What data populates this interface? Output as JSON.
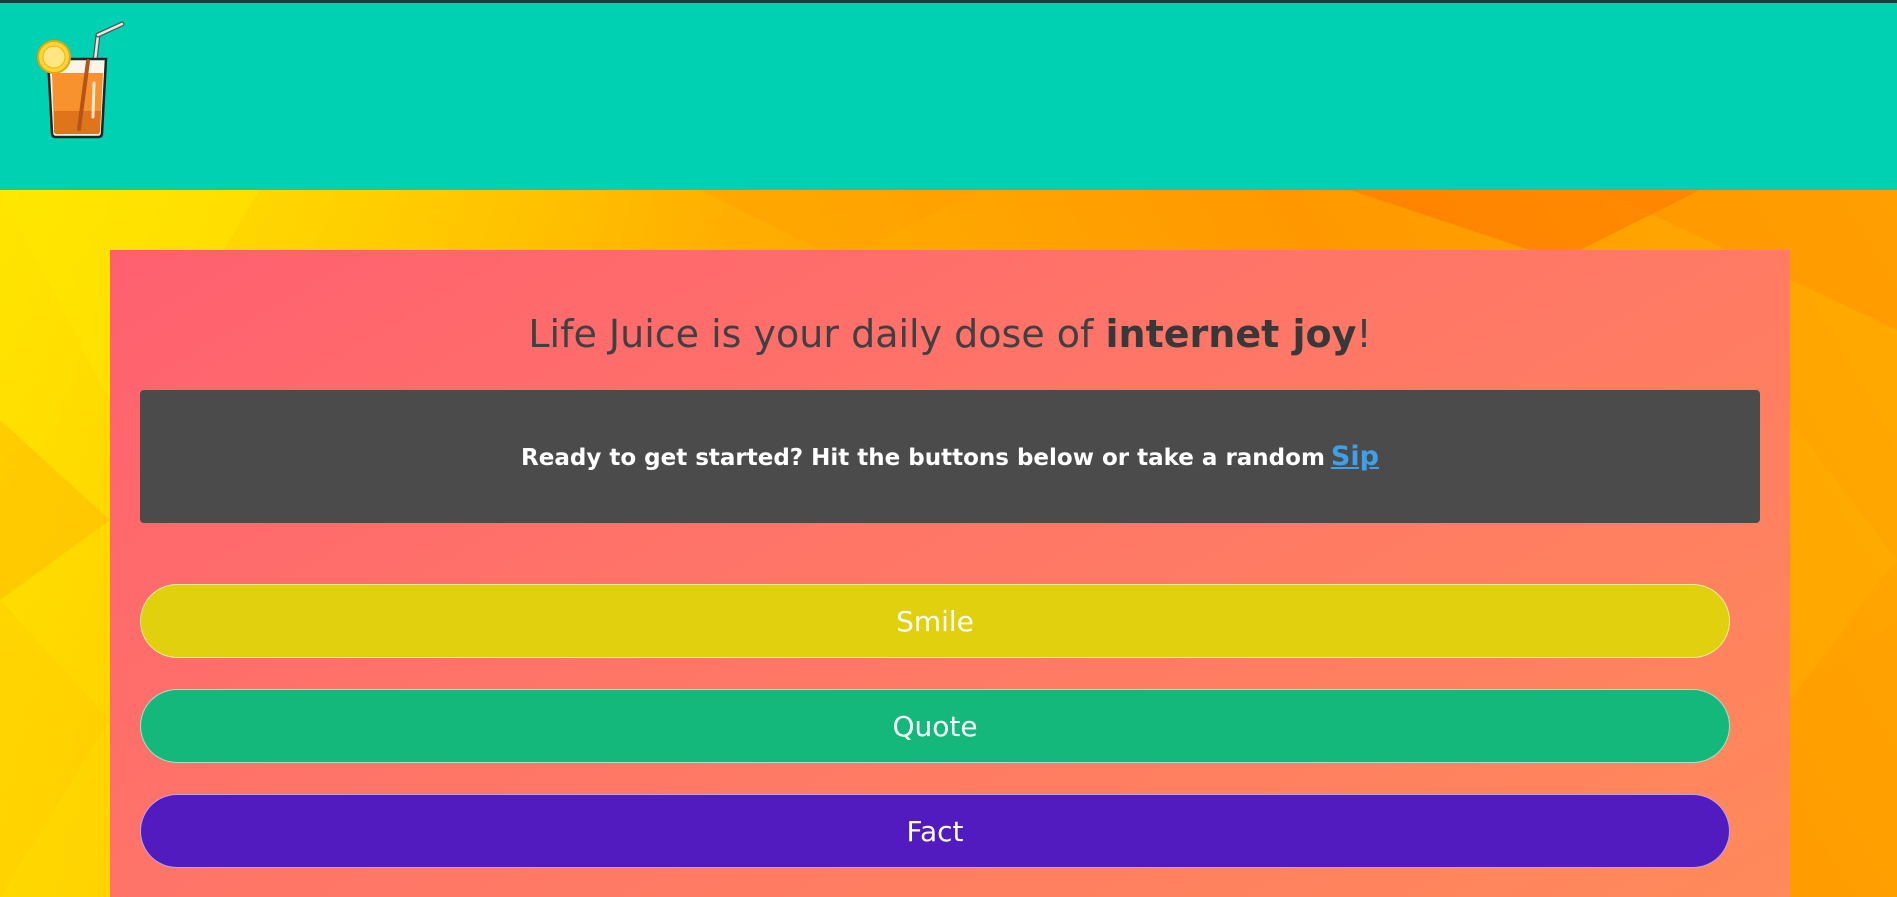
{
  "header": {
    "logo_icon": "juice-glass-icon",
    "background_color": "#00d1b2"
  },
  "main": {
    "headline_prefix": "Life Juice is your daily dose of ",
    "headline_emphasis": "internet joy",
    "headline_suffix": "!",
    "notice": {
      "text": "Ready to get started? Hit the buttons below or take a random",
      "link_label": "Sip"
    },
    "buttons": [
      {
        "label": "Smile",
        "color": "#e0d00e"
      },
      {
        "label": "Quote",
        "color": "#14b87a"
      },
      {
        "label": "Fact",
        "color": "#521bbf"
      }
    ]
  }
}
